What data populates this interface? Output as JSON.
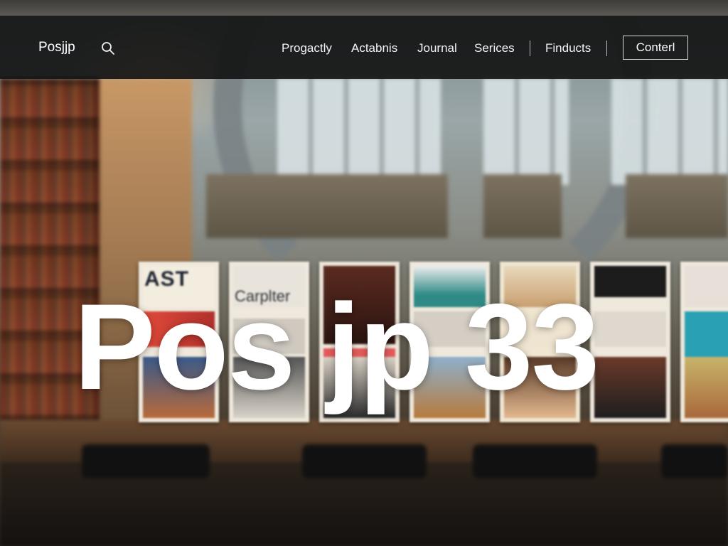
{
  "header": {
    "logo": "Posjjp",
    "search_icon": "search-icon",
    "nav": [
      {
        "label": "Progactly"
      },
      {
        "label": "Actabnis"
      },
      {
        "label": "Journal"
      },
      {
        "label": "Serices"
      },
      {
        "label": "Finducts"
      }
    ],
    "cta_label": "Conterl"
  },
  "hero": {
    "title": "Pos jp 33"
  },
  "posters": [
    {
      "headline": "AST",
      "sub": "",
      "accent": "#d33a35"
    },
    {
      "headline": "",
      "sub": "Carplter",
      "accent": "#6a6a6a"
    },
    {
      "headline": "",
      "sub": "",
      "accent": "#5b2a20"
    },
    {
      "headline": "",
      "sub": "",
      "accent": "#2f8a86"
    },
    {
      "headline": "",
      "sub": "",
      "accent": "#c9a070"
    },
    {
      "headline": "",
      "sub": "",
      "accent": "#1c1c1c"
    },
    {
      "headline": "",
      "sub": "",
      "accent": "#2aa0b4"
    }
  ],
  "colors": {
    "navbar_bg": "#0e0e0e",
    "text_light": "#ffffff"
  }
}
